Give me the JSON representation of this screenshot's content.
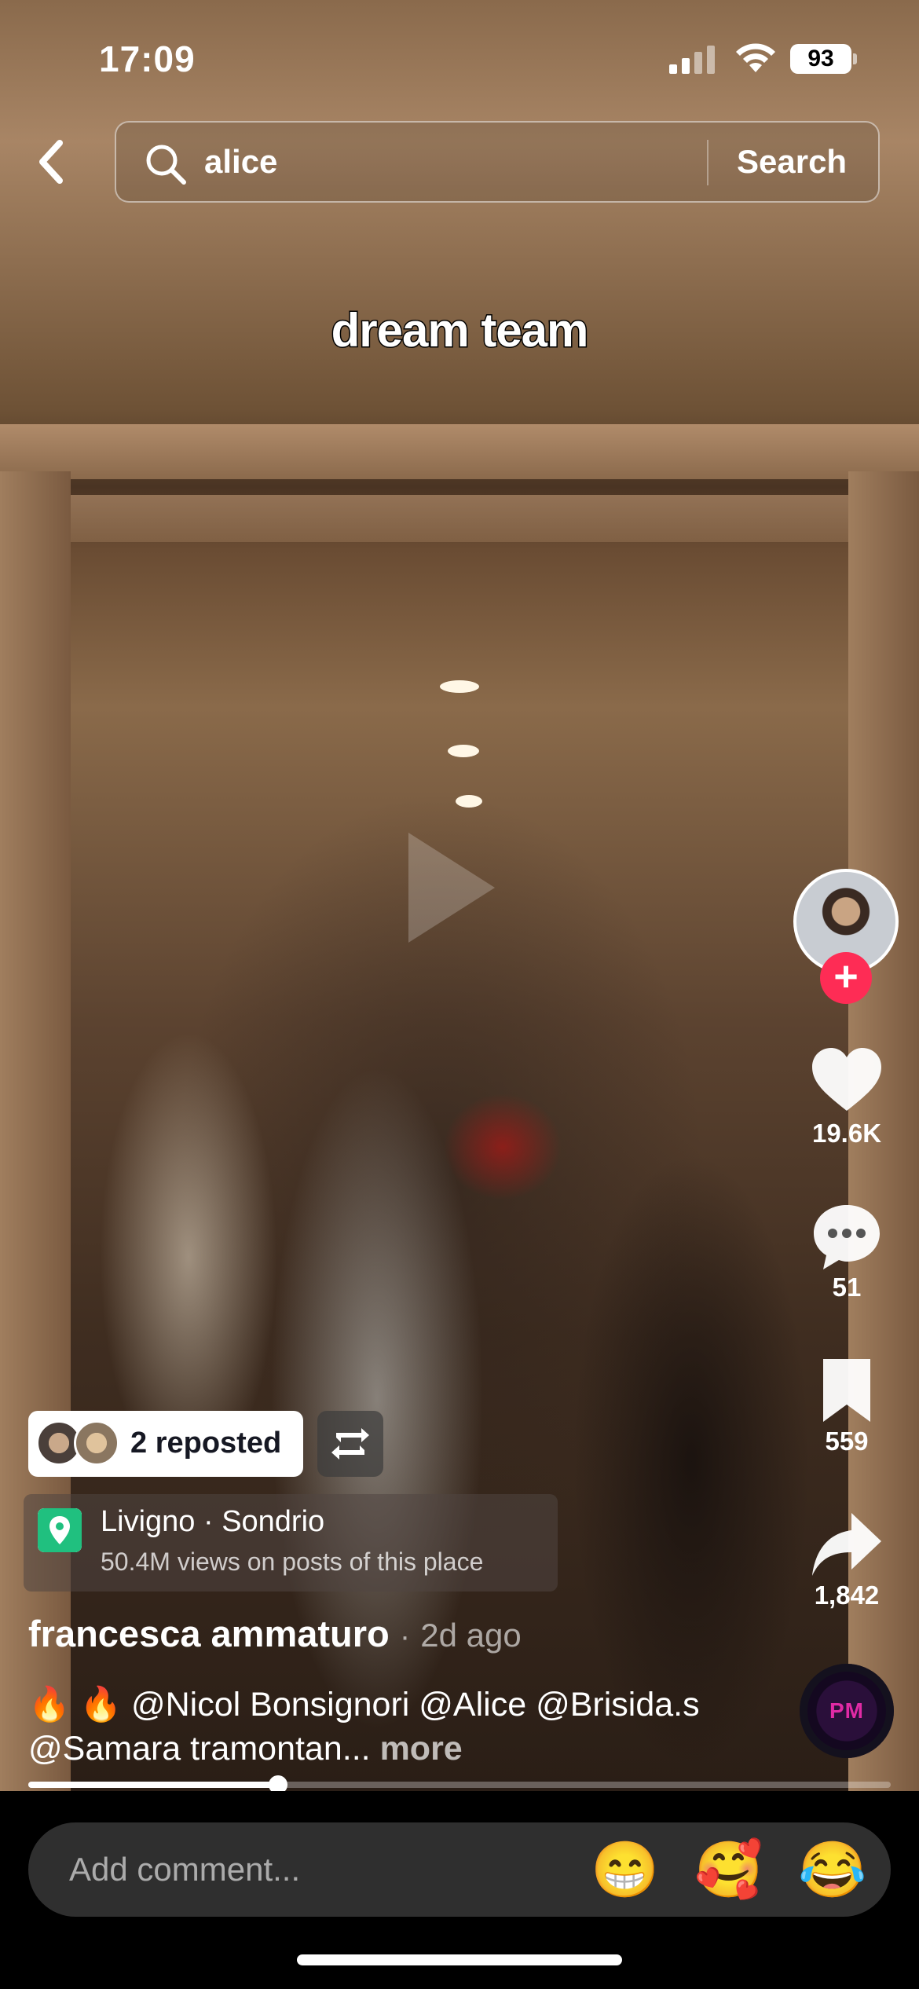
{
  "status_bar": {
    "time": "17:09",
    "battery": "93"
  },
  "search": {
    "query": "alice",
    "button_label": "Search"
  },
  "video": {
    "overlay_caption": "dream team",
    "progress": 0.29
  },
  "actions": {
    "likes": "19.6K",
    "comments": "51",
    "saves": "559",
    "shares": "1,842",
    "music_label": "PM"
  },
  "repost": {
    "label": "2 reposted"
  },
  "location": {
    "title": "Livigno · Sondrio",
    "subtitle": "50.4M views on posts of this place"
  },
  "post": {
    "author": "francesca ammaturo",
    "separator": "·",
    "time_ago": "2d ago",
    "description": "🔥 🔥 @Nicol Bonsignori @Alice @Brisida.s @Samara tramontan...",
    "more_label": "more"
  },
  "comment_bar": {
    "placeholder": "Add comment...",
    "emojis": [
      "😁",
      "🥰",
      "😂"
    ]
  },
  "colors": {
    "follow": "#fe2c55",
    "location_icon": "#20c07f",
    "comment_bg": "#2f2f2f"
  }
}
